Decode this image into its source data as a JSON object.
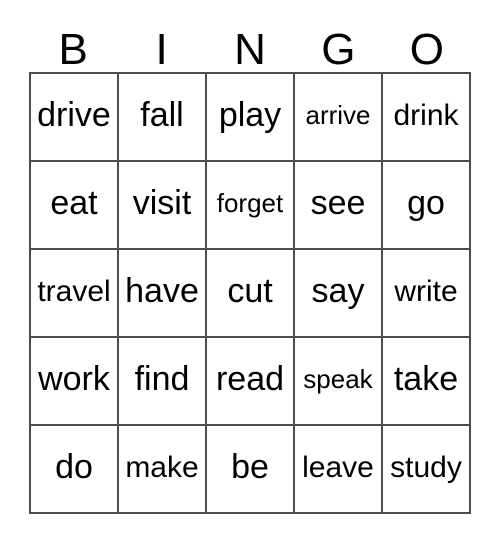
{
  "card": {
    "title": "BINGO card",
    "header_letters": [
      "B",
      "I",
      "N",
      "G",
      "O"
    ],
    "border_color": "#4d4d4d",
    "text_color": "#000000",
    "background_color": "#ffffff",
    "grid_size": "5x5",
    "rows": [
      [
        {
          "text": "drive",
          "fit": ""
        },
        {
          "text": "fall",
          "fit": ""
        },
        {
          "text": "play",
          "fit": ""
        },
        {
          "text": "arrive",
          "fit": "fit-xs"
        },
        {
          "text": "drink",
          "fit": "fit-sm"
        }
      ],
      [
        {
          "text": "eat",
          "fit": ""
        },
        {
          "text": "visit",
          "fit": ""
        },
        {
          "text": "forget",
          "fit": "fit-xs"
        },
        {
          "text": "see",
          "fit": ""
        },
        {
          "text": "go",
          "fit": ""
        }
      ],
      [
        {
          "text": "travel",
          "fit": "fit-sm"
        },
        {
          "text": "have",
          "fit": ""
        },
        {
          "text": "cut",
          "fit": ""
        },
        {
          "text": "say",
          "fit": ""
        },
        {
          "text": "write",
          "fit": "fit-sm"
        }
      ],
      [
        {
          "text": "work",
          "fit": ""
        },
        {
          "text": "find",
          "fit": ""
        },
        {
          "text": "read",
          "fit": ""
        },
        {
          "text": "speak",
          "fit": "fit-xs"
        },
        {
          "text": "take",
          "fit": ""
        }
      ],
      [
        {
          "text": "do",
          "fit": ""
        },
        {
          "text": "make",
          "fit": "fit-sm"
        },
        {
          "text": "be",
          "fit": ""
        },
        {
          "text": "leave",
          "fit": "fit-sm"
        },
        {
          "text": "study",
          "fit": "fit-sm"
        }
      ]
    ]
  }
}
